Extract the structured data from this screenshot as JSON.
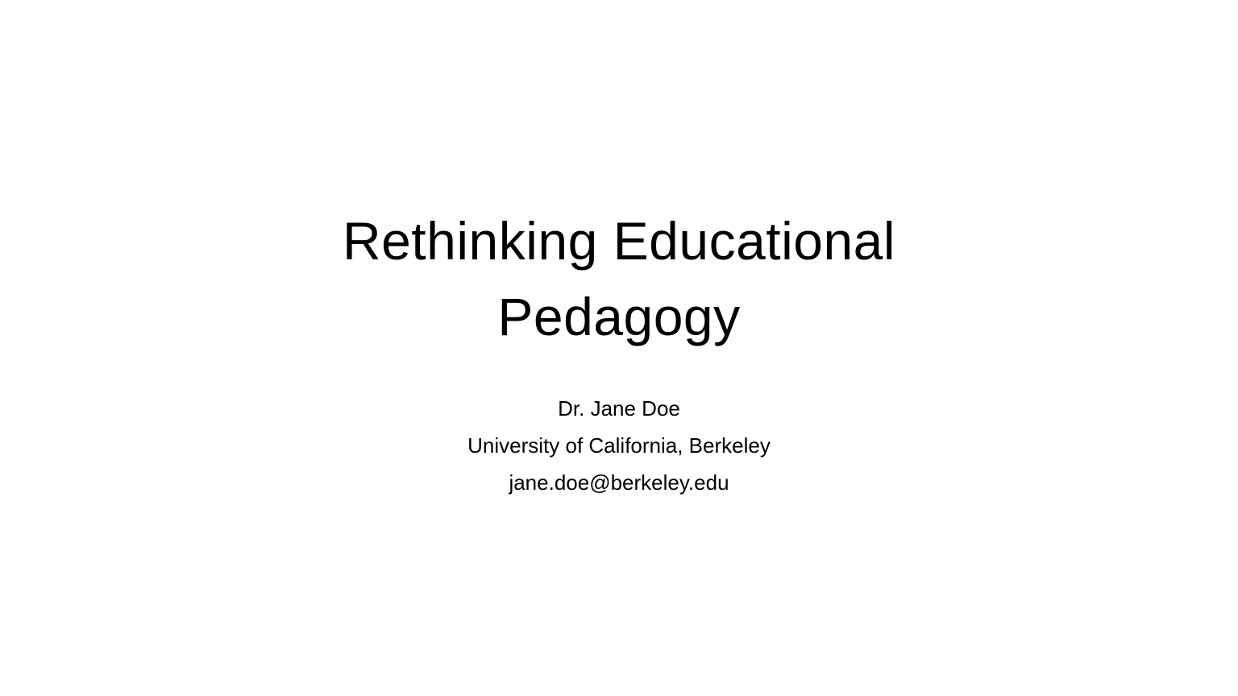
{
  "slide": {
    "title_lines": [
      "Rethinking Educational",
      "Pedagogy"
    ],
    "author": "Dr. Jane Doe",
    "affiliation": "University of California, Berkeley",
    "email": "jane.doe@berkeley.edu"
  },
  "colors": {
    "background": "#ffffff",
    "text": "#000000"
  }
}
